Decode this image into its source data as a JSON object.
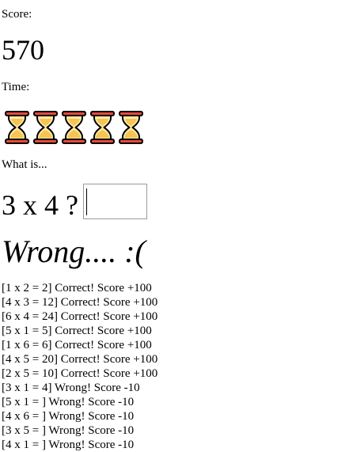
{
  "score": {
    "label": "Score:",
    "value": "570"
  },
  "time": {
    "label": "Time:",
    "hourglass_icons_remaining": 5,
    "icon": "hourglass-icon",
    "colors": {
      "frame": "#000000",
      "glass": "#e64a3a",
      "sand": "#f6c452",
      "sand_light": "#ffe9a8"
    }
  },
  "question": {
    "label": "What is...",
    "text": "3 x 4 ?",
    "answer_value": ""
  },
  "feedback": "Wrong.... :(",
  "history": [
    "[1 x 2 = 2] Correct! Score +100",
    "[4 x 3 = 12] Correct! Score +100",
    "[6 x 4 = 24] Correct! Score +100",
    "[5 x 1 = 5] Correct! Score +100",
    "[1 x 6 = 6] Correct! Score +100",
    "[4 x 5 = 20] Correct! Score +100",
    "[2 x 5 = 10] Correct! Score +100",
    "[3 x 1 = 4] Wrong! Score -10",
    "[5 x 1 = ] Wrong! Score -10",
    "[4 x 6 = ] Wrong! Score -10",
    "[3 x 5 = ] Wrong! Score -10",
    "[4 x 1 = ] Wrong! Score -10"
  ]
}
